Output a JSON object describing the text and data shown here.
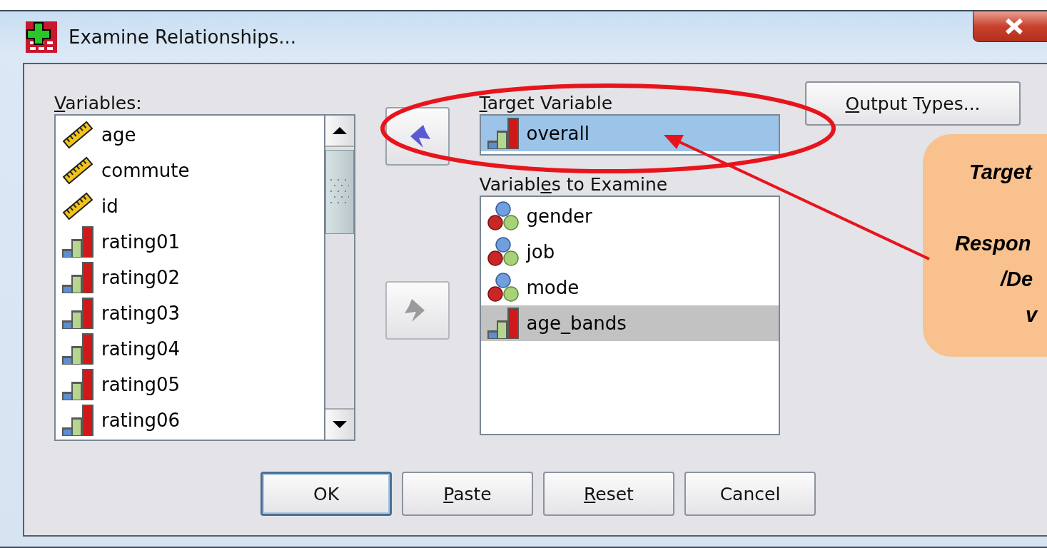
{
  "window": {
    "title": "Examine Relationships..."
  },
  "variables": {
    "label": "Variables:",
    "items": [
      {
        "name": "age",
        "kind": "scale",
        "selected": false
      },
      {
        "name": "commute",
        "kind": "scale",
        "selected": false
      },
      {
        "name": "id",
        "kind": "scale",
        "selected": false
      },
      {
        "name": "rating01",
        "kind": "ordinal",
        "selected": false
      },
      {
        "name": "rating02",
        "kind": "ordinal",
        "selected": false
      },
      {
        "name": "rating03",
        "kind": "ordinal",
        "selected": false
      },
      {
        "name": "rating04",
        "kind": "ordinal",
        "selected": false
      },
      {
        "name": "rating05",
        "kind": "ordinal",
        "selected": false
      },
      {
        "name": "rating06",
        "kind": "ordinal",
        "selected": false
      }
    ]
  },
  "move_buttons": [
    {
      "kind": "left",
      "disabled": false
    },
    {
      "kind": "right",
      "disabled": true
    }
  ],
  "target": {
    "label": "Target Variable",
    "name": "overall",
    "kind": "ordinal",
    "selected": true
  },
  "examine": {
    "label": "Variables to Examine",
    "items": [
      {
        "name": "gender",
        "kind": "nominal",
        "selected": false
      },
      {
        "name": "job",
        "kind": "nominal",
        "selected": false
      },
      {
        "name": "mode",
        "kind": "nominal",
        "selected": false
      },
      {
        "name": "age_bands",
        "kind": "ordinal",
        "selected": true
      }
    ]
  },
  "output_types_button": {
    "label": "Output Types..."
  },
  "callout": {
    "lines": [
      "Target",
      "Respon",
      "/De",
      "v"
    ]
  },
  "buttons": [
    {
      "label": "OK",
      "default": true
    },
    {
      "label": "Paste",
      "default": false
    },
    {
      "label": "Reset",
      "default": false
    },
    {
      "label": "Cancel",
      "default": false
    }
  ]
}
